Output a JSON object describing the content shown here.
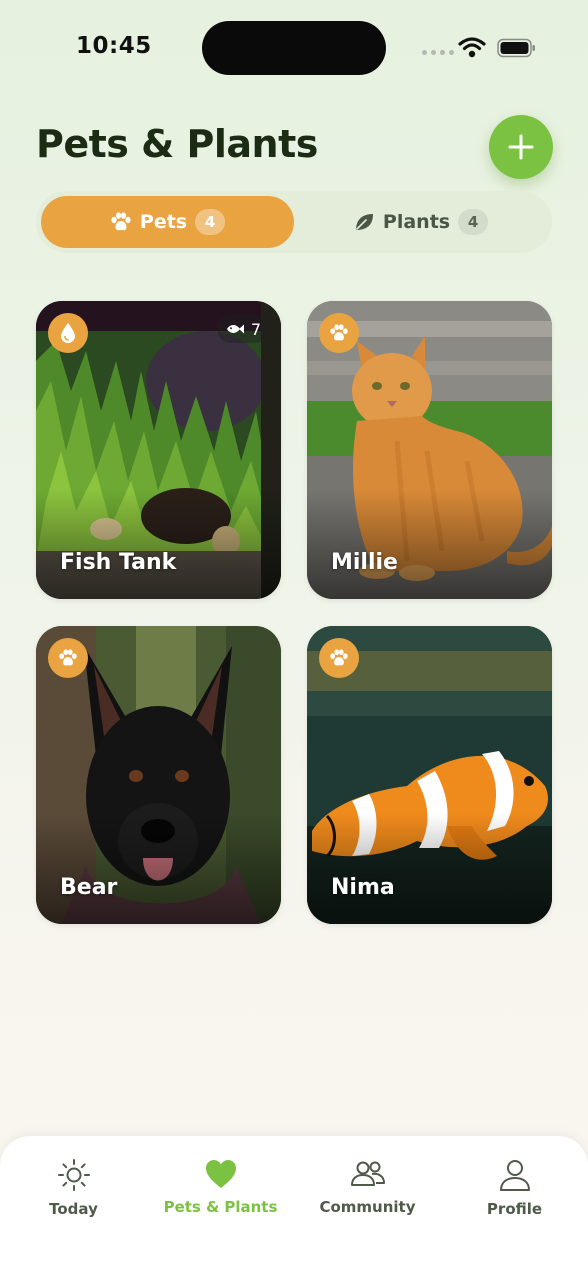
{
  "status_bar": {
    "time": "10:45"
  },
  "header": {
    "title": "Pets & Plants"
  },
  "tabs": [
    {
      "label": "Pets",
      "count": "4",
      "icon": "paw-icon",
      "active": true
    },
    {
      "label": "Plants",
      "count": "4",
      "icon": "leaf-icon",
      "active": false
    }
  ],
  "cards": [
    {
      "name": "Fish Tank",
      "badge_icon": "water-drop-icon",
      "count_icon": "fish-icon",
      "count": "7"
    },
    {
      "name": "Millie",
      "badge_icon": "paw-icon"
    },
    {
      "name": "Bear",
      "badge_icon": "paw-icon"
    },
    {
      "name": "Nima",
      "badge_icon": "paw-icon"
    }
  ],
  "nav": [
    {
      "label": "Today",
      "icon": "sun-icon",
      "active": false
    },
    {
      "label": "Pets & Plants",
      "icon": "heart-icon",
      "active": true
    },
    {
      "label": "Community",
      "icon": "people-icon",
      "active": false
    },
    {
      "label": "Profile",
      "icon": "person-icon",
      "active": false
    }
  ],
  "colors": {
    "accent_green": "#7cc242",
    "accent_orange": "#e9a441",
    "title": "#1b2b14"
  }
}
